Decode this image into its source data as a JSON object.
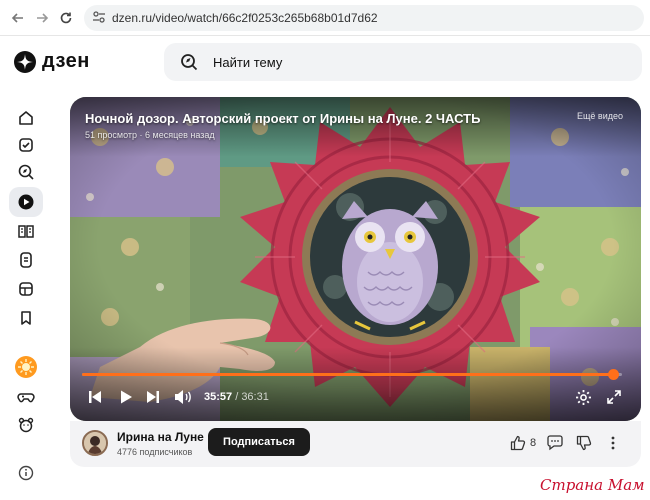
{
  "browser": {
    "url": "dzen.ru/video/watch/66c2f0253c265b68b01d7d62"
  },
  "header": {
    "logo_text": "дзен",
    "search_placeholder": "Найти тему"
  },
  "sidebar": {
    "items": [
      {
        "icon": "home-icon"
      },
      {
        "icon": "subscriptions-icon"
      },
      {
        "icon": "explore-icon"
      },
      {
        "icon": "video-icon",
        "active": true
      },
      {
        "icon": "articles-icon"
      },
      {
        "icon": "shorts-icon"
      },
      {
        "icon": "games-shop-icon"
      },
      {
        "icon": "bookmark-icon"
      },
      {
        "icon": "sun-avatar-icon"
      },
      {
        "icon": "gamepad-icon"
      },
      {
        "icon": "kids-icon"
      },
      {
        "icon": "info-icon"
      }
    ]
  },
  "video": {
    "title": "Ночной дозор. Авторский проект от Ирины на Луне. 2 ЧАСТЬ",
    "meta": "51 просмотр · 6 месяцев назад",
    "more_label": "Ещё видео",
    "current_time": "35:57",
    "separator": " / ",
    "duration": "36:31",
    "progress": 0.984
  },
  "channel": {
    "name": "Ирина на Луне",
    "subscribers": "4776 подписчиков",
    "subscribe_label": "Подписаться",
    "likes": "8"
  },
  "watermark": "Страна Мам",
  "colors": {
    "accent": "#ff6f1a",
    "subscribe_bg": "#1c1c1c",
    "watermark": "#c8102e"
  }
}
